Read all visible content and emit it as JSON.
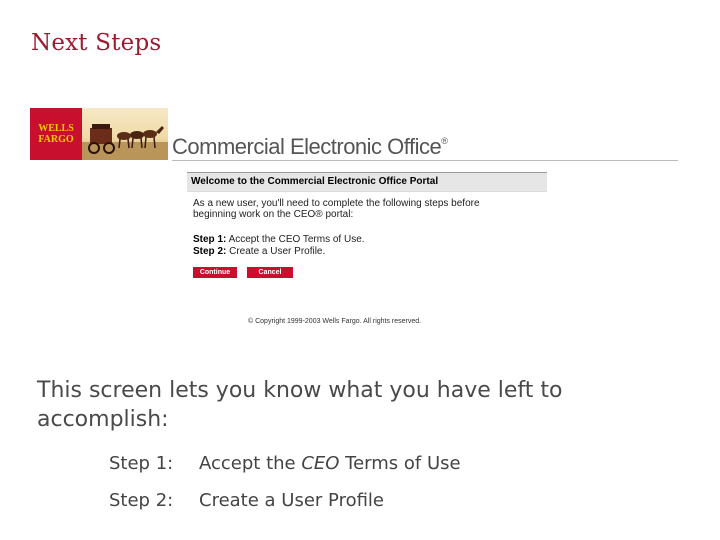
{
  "slide": {
    "title": "Next Steps",
    "description": "This screen lets you know what you have left to accomplish:",
    "steps": [
      {
        "label": "Step 1:",
        "text_pre": "Accept the ",
        "text_em": "CEO",
        "text_post": " Terms of Use"
      },
      {
        "label": "Step 2:",
        "text_pre": "Create a User Profile",
        "text_em": "",
        "text_post": ""
      }
    ]
  },
  "screenshot": {
    "logo_line1": "WELLS",
    "logo_line2": "FARGO",
    "product_name": "Commercial Electronic Office",
    "product_mark": "®",
    "portal_title": "Welcome to the Commercial Electronic Office Portal",
    "intro": "As a new user, you'll need to complete the following steps before beginning work on the CEO® portal:",
    "steps": [
      {
        "label": "Step 1:",
        "text": "Accept the CEO Terms of Use."
      },
      {
        "label": "Step 2:",
        "text": "Create a User Profile."
      }
    ],
    "buttons": {
      "continue": "Continue",
      "cancel": "Cancel"
    },
    "copyright": "© Copyright 1999-2003 Wells Fargo. All rights reserved."
  },
  "colors": {
    "title": "#9b1b30",
    "brand_red": "#c8102e",
    "brand_gold": "#f6c900"
  }
}
